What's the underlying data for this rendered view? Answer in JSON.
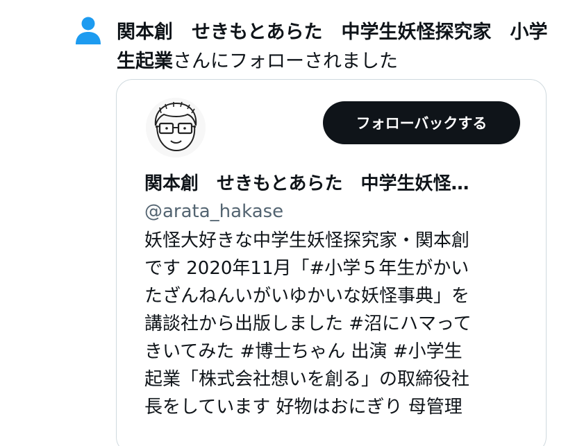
{
  "notification": {
    "icon": "person-icon",
    "icon_color": "#1d9bf0",
    "display_name": "関本創　せきもとあらた　中学生妖怪探究家　小学生起業",
    "message_suffix": "さんにフォローされました"
  },
  "profile_card": {
    "follow_back_label": "フォローバックする",
    "name": "関本創　せきもとあらた　中学生妖怪…",
    "handle": "@arata_hakase",
    "bio_lines": [
      "妖怪大好きな中学生妖怪探究家・関本創",
      "です 2020年11月「#小学５年生がかい",
      "たざんねんいがいゆかいな妖怪事典」を",
      "講談社から出版しました #沼にハマって",
      "きいてみた #博士ちゃん 出演 #小学生",
      "起業「株式会社想いを創る」の取締役社",
      "長をしています 好物はおにぎり 母管理"
    ]
  }
}
